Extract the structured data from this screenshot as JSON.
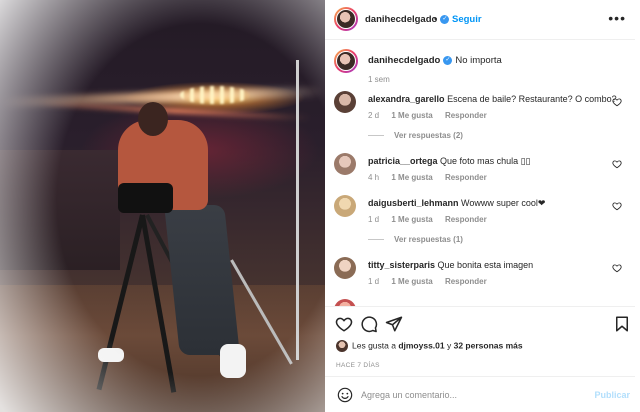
{
  "post": {
    "author": "danihecdelgado",
    "follow_label": "Seguir",
    "more_icon": "more-options-icon"
  },
  "caption": {
    "username": "danihecdelgado",
    "text": "No importa",
    "time": "1 sem"
  },
  "comments": [
    {
      "username": "alexandra_garello",
      "text": "Escena de baile? Restaurante? O combo?",
      "time": "2 d",
      "likes": "1 Me gusta",
      "reply": "Responder",
      "view_replies": "Ver respuestas (2)"
    },
    {
      "username": "patricia__ortega",
      "text": "Que foto mas chula ▯▯",
      "time": "4 h",
      "likes": "1 Me gusta",
      "reply": "Responder",
      "view_replies": ""
    },
    {
      "username": "daigusberti_lehmann",
      "text": "Wowww super cool❤",
      "time": "1 d",
      "likes": "1 Me gusta",
      "reply": "Responder",
      "view_replies": "Ver respuestas (1)"
    },
    {
      "username": "titty_sisterparis",
      "text": "Que bonita esta imagen",
      "time": "1 d",
      "likes": "1 Me gusta",
      "reply": "Responder",
      "view_replies": ""
    }
  ],
  "likes_summary": {
    "prefix": "Les gusta a ",
    "user": "djmoyss.01",
    "middle": " y ",
    "others": "32 personas más"
  },
  "timestamp": "HACE 7 DÍAS",
  "add_comment": {
    "placeholder": "Agrega un comentario...",
    "publish_label": "Publicar"
  },
  "colors": {
    "accent": "#0095f6",
    "verified": "#3897f0",
    "muted": "#8e8e8e",
    "text": "#262626"
  }
}
